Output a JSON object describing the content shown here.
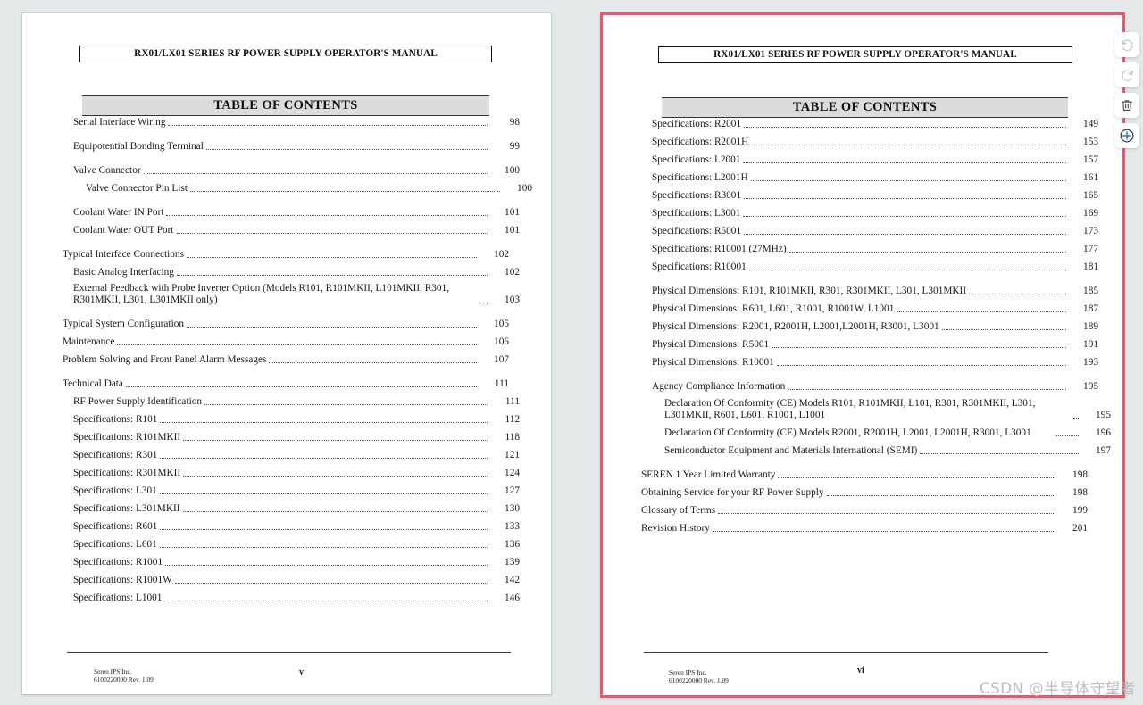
{
  "viewer": {
    "background_color": "#e4e9ea",
    "selected_page_border_color": "#e8596d",
    "watermark": "CSDN @半导体守望者"
  },
  "toolbar": {
    "buttons": [
      {
        "name": "rotate-left-icon",
        "label": "Rotate left"
      },
      {
        "name": "rotate-right-icon",
        "label": "Rotate right"
      },
      {
        "name": "trash-icon",
        "label": "Delete"
      },
      {
        "name": "add-circle-icon",
        "label": "Add"
      }
    ],
    "accent_color": "#2f6fd0"
  },
  "pages": [
    {
      "id": "page-left",
      "selected": false,
      "running_header": "RX01/LX01 SERIES RF POWER SUPPLY OPERATOR'S MANUAL",
      "toc_title": "TABLE OF CONTENTS",
      "folio": "v",
      "footer": {
        "company": "Seren IPS Inc.",
        "document_number": "6100220000 Rev. 1.09"
      },
      "entries": [
        {
          "type": "entry",
          "indent": 1,
          "label": "Serial Interface Wiring",
          "page": "98"
        },
        {
          "type": "gap",
          "size": "big"
        },
        {
          "type": "entry",
          "indent": 1,
          "label": "Equipotential Bonding Terminal",
          "page": "99"
        },
        {
          "type": "gap",
          "size": "big"
        },
        {
          "type": "entry",
          "indent": 1,
          "label": "Valve Connector",
          "page": "100"
        },
        {
          "type": "entry",
          "indent": 2,
          "label": "Valve Connector Pin List",
          "page": "100"
        },
        {
          "type": "gap",
          "size": "big"
        },
        {
          "type": "entry",
          "indent": 1,
          "label": "Coolant Water IN Port",
          "page": "101"
        },
        {
          "type": "entry",
          "indent": 1,
          "label": "Coolant Water OUT Port",
          "page": "101"
        },
        {
          "type": "gap",
          "size": "big"
        },
        {
          "type": "entry",
          "indent": 0,
          "label": "Typical Interface Connections",
          "page": "102"
        },
        {
          "type": "entry",
          "indent": 1,
          "label": "Basic Analog Interfacing",
          "page": "102"
        },
        {
          "type": "entry",
          "indent": 1,
          "wrap": true,
          "label": "External Feedback with Probe Inverter Option (Models R101, R101MKII, L101MKII, R301, R301MKII, L301, L301MKII only)",
          "page": "103"
        },
        {
          "type": "gap",
          "size": "big"
        },
        {
          "type": "entry",
          "indent": 0,
          "label": "Typical System Configuration",
          "page": "105"
        },
        {
          "type": "entry",
          "indent": 0,
          "label": "Maintenance",
          "page": "106"
        },
        {
          "type": "entry",
          "indent": 0,
          "label": "Problem Solving and Front Panel Alarm Messages",
          "page": "107"
        },
        {
          "type": "gap",
          "size": "big"
        },
        {
          "type": "entry",
          "indent": 0,
          "label": "Technical Data",
          "page": "111"
        },
        {
          "type": "entry",
          "indent": 1,
          "label": "RF Power Supply Identification",
          "page": "111"
        },
        {
          "type": "entry",
          "indent": 1,
          "label": "Specifications: R101",
          "page": "112"
        },
        {
          "type": "entry",
          "indent": 1,
          "label": "Specifications: R101MKII",
          "page": "118"
        },
        {
          "type": "entry",
          "indent": 1,
          "label": "Specifications: R301",
          "page": "121"
        },
        {
          "type": "entry",
          "indent": 1,
          "label": "Specifications: R301MKII",
          "page": "124"
        },
        {
          "type": "entry",
          "indent": 1,
          "label": "Specifications: L301",
          "page": "127"
        },
        {
          "type": "entry",
          "indent": 1,
          "label": "Specifications: L301MKII",
          "page": "130"
        },
        {
          "type": "entry",
          "indent": 1,
          "label": "Specifications: R601",
          "page": "133"
        },
        {
          "type": "entry",
          "indent": 1,
          "label": "Specifications: L601",
          "page": "136"
        },
        {
          "type": "entry",
          "indent": 1,
          "label": "Specifications: R1001",
          "page": "139"
        },
        {
          "type": "entry",
          "indent": 1,
          "label": "Specifications: R1001W",
          "page": "142"
        },
        {
          "type": "entry",
          "indent": 1,
          "label": "Specifications: L1001",
          "page": "146"
        }
      ]
    },
    {
      "id": "page-right",
      "selected": true,
      "running_header": "RX01/LX01 SERIES RF POWER SUPPLY OPERATOR'S MANUAL",
      "toc_title": "TABLE OF CONTENTS",
      "folio": "vi",
      "footer": {
        "company": "Seren IPS Inc.",
        "document_number": "6100220000 Rev. 1.09"
      },
      "entries": [
        {
          "type": "entry",
          "indent": 1,
          "label": "Specifications: R2001",
          "page": "149"
        },
        {
          "type": "entry",
          "indent": 1,
          "label": "Specifications: R2001H",
          "page": "153"
        },
        {
          "type": "entry",
          "indent": 1,
          "label": "Specifications: L2001",
          "page": "157"
        },
        {
          "type": "entry",
          "indent": 1,
          "label": "Specifications: L2001H",
          "page": "161"
        },
        {
          "type": "entry",
          "indent": 1,
          "label": "Specifications: R3001",
          "page": "165"
        },
        {
          "type": "entry",
          "indent": 1,
          "label": "Specifications: L3001",
          "page": "169"
        },
        {
          "type": "entry",
          "indent": 1,
          "label": "Specifications: R5001",
          "page": "173"
        },
        {
          "type": "entry",
          "indent": 1,
          "label": "Specifications: R10001  (27MHz)",
          "page": "177"
        },
        {
          "type": "entry",
          "indent": 1,
          "label": "Specifications: R10001",
          "page": "181"
        },
        {
          "type": "gap",
          "size": "big"
        },
        {
          "type": "entry",
          "indent": 1,
          "label": "Physical Dimensions: R101, R101MKII, R301, R301MKII, L301, L301MKII",
          "page": "185"
        },
        {
          "type": "entry",
          "indent": 1,
          "label": "Physical Dimensions: R601, L601, R1001, R1001W, L1001",
          "page": "187"
        },
        {
          "type": "entry",
          "indent": 1,
          "label": "Physical Dimensions: R2001, R2001H, L2001,L2001H, R3001, L3001",
          "page": "189"
        },
        {
          "type": "entry",
          "indent": 1,
          "label": "Physical Dimensions: R5001",
          "page": "191"
        },
        {
          "type": "entry",
          "indent": 1,
          "label": "Physical Dimensions: R10001",
          "page": "193"
        },
        {
          "type": "gap",
          "size": "big"
        },
        {
          "type": "entry",
          "indent": 1,
          "label": "Agency Compliance Information",
          "page": "195"
        },
        {
          "type": "gap",
          "size": "small"
        },
        {
          "type": "entry",
          "indent": 2,
          "wrap": true,
          "label": "Declaration Of Conformity (CE) Models R101, R101MKII, L101, R301, R301MKII, L301, L301MKII, R601, L601, R1001, L1001",
          "page": "195"
        },
        {
          "type": "gap",
          "size": "small"
        },
        {
          "type": "entry",
          "indent": 2,
          "wrap": true,
          "label": "Declaration Of Conformity (CE) Models R2001, R2001H, L2001, L2001H, R3001, L3001",
          "page": "196"
        },
        {
          "type": "gap",
          "size": "small"
        },
        {
          "type": "entry",
          "indent": 2,
          "label": "Semiconductor Equipment and Materials International (SEMI)",
          "page": "197"
        },
        {
          "type": "gap",
          "size": "big"
        },
        {
          "type": "entry",
          "indent": 0,
          "label": "SEREN 1 Year Limited Warranty",
          "page": "198"
        },
        {
          "type": "entry",
          "indent": 0,
          "label": "Obtaining Service for your RF Power Supply",
          "page": "198"
        },
        {
          "type": "entry",
          "indent": 0,
          "label": "Glossary of Terms",
          "page": "199"
        },
        {
          "type": "entry",
          "indent": 0,
          "label": "Revision History",
          "page": "201"
        }
      ]
    }
  ]
}
